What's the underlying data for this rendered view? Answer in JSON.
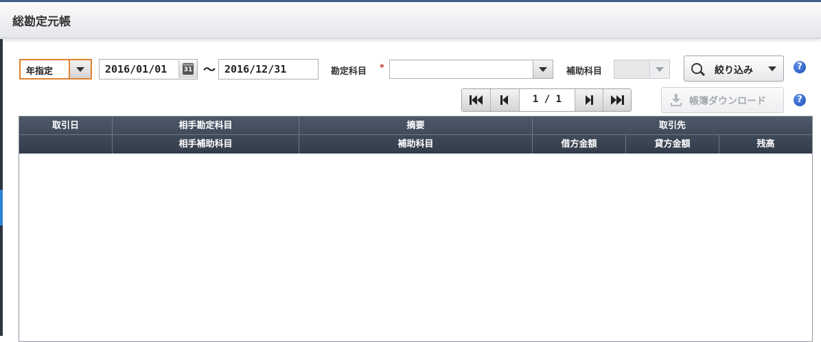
{
  "header": {
    "title": "総勘定元帳"
  },
  "filters": {
    "period_mode": "年指定",
    "date_from": "2016/01/01",
    "calendar_day": "31",
    "range_separator": "〜",
    "date_to": "2016/12/31",
    "account_label": "勘定科目",
    "required_mark": "*",
    "account_value": "",
    "sub_account_label": "補助科目",
    "sub_account_value": "",
    "filter_button": "絞り込み",
    "help": "?"
  },
  "pager": {
    "current": "1",
    "separator": "/",
    "total": "1"
  },
  "download": {
    "label": "帳簿ダウンロード",
    "help": "?"
  },
  "table": {
    "header_row1": [
      "取引日",
      "相手勘定科目",
      "摘要",
      "取引先"
    ],
    "header_row2": [
      "",
      "相手補助科目",
      "補助科目",
      "借方金額",
      "貸方金額",
      "残高"
    ],
    "rows": []
  },
  "colors": {
    "accent": "#e0802e",
    "header_bg": "#3d4757",
    "help": "#2a5fc9"
  }
}
